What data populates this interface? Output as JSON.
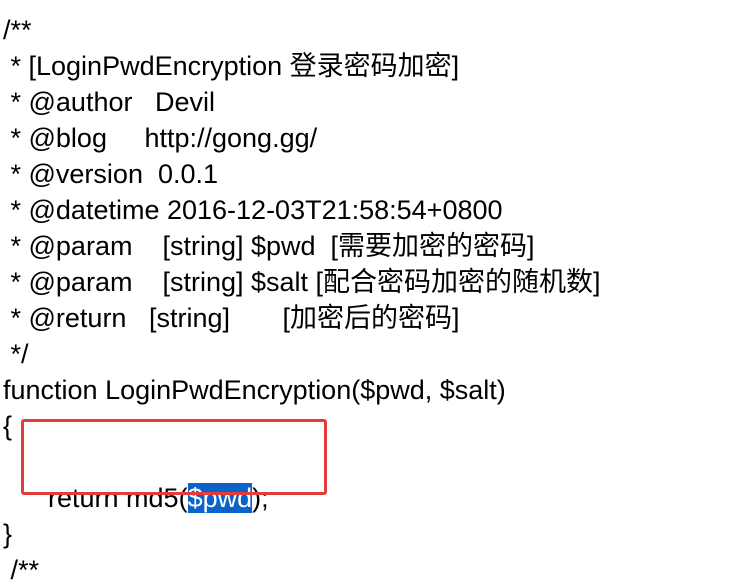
{
  "code": {
    "lines": [
      "/**",
      " * [LoginPwdEncryption 登录密码加密]",
      " * @author   Devil",
      " * @blog     http://gong.gg/",
      " * @version  0.0.1",
      " * @datetime 2016-12-03T21:58:54+0800",
      " * @param    [string] $pwd  [需要加密的密码]",
      " * @param    [string] $salt [配合密码加密的随机数]",
      " * @return   [string]       [加密后的密码]",
      " */",
      "function LoginPwdEncryption($pwd, $salt)",
      "{",
      "",
      "}",
      " /**"
    ],
    "return_line": {
      "prefix": "  return md5(",
      "selected": "$pwd",
      "suffix": ");"
    }
  },
  "colors": {
    "selection": "#0a63c9",
    "annotation_box": "#e53b3b"
  }
}
